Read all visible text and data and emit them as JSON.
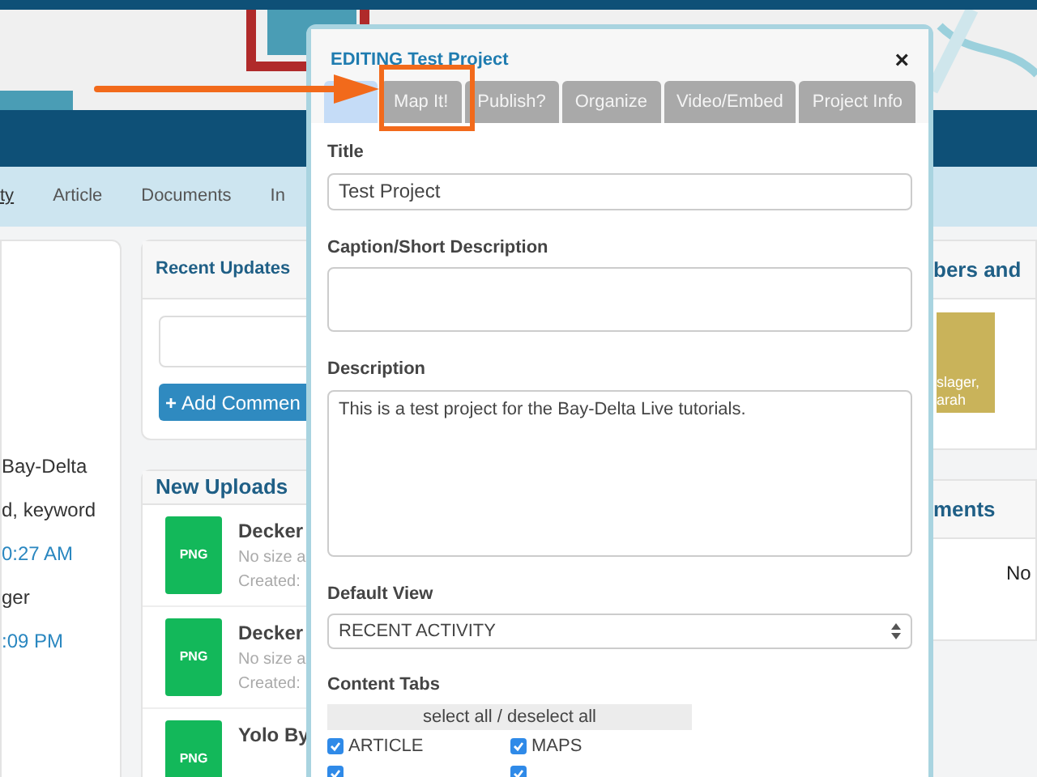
{
  "nav": {
    "items": [
      {
        "label": "ty",
        "selected": true
      },
      {
        "label": "Article",
        "selected": false
      },
      {
        "label": "Documents",
        "selected": false
      },
      {
        "label": "In",
        "selected": false
      }
    ]
  },
  "left_panel": {
    "entries": [
      {
        "text": "Bay-Delta",
        "kind": "text"
      },
      {
        "text": "d, keyword",
        "kind": "text"
      },
      {
        "text": "0:27 AM",
        "kind": "link"
      },
      {
        "text": "ger",
        "kind": "text"
      },
      {
        "text": ":09 PM",
        "kind": "link"
      }
    ]
  },
  "recent_updates": {
    "title": "Recent Updates",
    "button_icon": "+",
    "button": "Add Commen"
  },
  "new_uploads": {
    "title": "New Uploads",
    "items": [
      {
        "icon": "PNG",
        "name": "Decker",
        "size": "No size a",
        "created": "Created:"
      },
      {
        "icon": "PNG",
        "name": "Decker",
        "size": "No size a",
        "created": "Created:"
      },
      {
        "icon": "PNG",
        "name": "Yolo By"
      }
    ]
  },
  "right_panel": {
    "members_title": "bers and",
    "photo_caption": [
      "slager,",
      "arah"
    ],
    "comments_title": "ments",
    "comments_empty": "No"
  },
  "dialog": {
    "title": "EDITING Test Project",
    "close": "×",
    "tabs": [
      {
        "selected": true
      },
      {
        "label": "Map It!",
        "selected": false
      },
      {
        "label": "Publish?",
        "selected": false
      },
      {
        "label": "Organize",
        "selected": false
      },
      {
        "label": "Video/Embed",
        "selected": false
      },
      {
        "label": "Project Info",
        "selected": false
      }
    ],
    "title_field": {
      "label": "Title",
      "value": "Test Project"
    },
    "caption_field": {
      "label": "Caption/Short Description"
    },
    "description_field": {
      "label": "Description",
      "value": "This is a test project for the Bay-Delta Live tutorials."
    },
    "default_view": {
      "label": "Default View",
      "value": "RECENT ACTIVITY"
    },
    "content_tabs": {
      "label": "Content Tabs",
      "select_all": "select all / deselect all",
      "options": [
        {
          "label": "ARTICLE",
          "checked": true
        },
        {
          "label": "MAPS",
          "checked": true
        },
        {
          "checked": true
        },
        {
          "checked": true
        }
      ]
    }
  }
}
